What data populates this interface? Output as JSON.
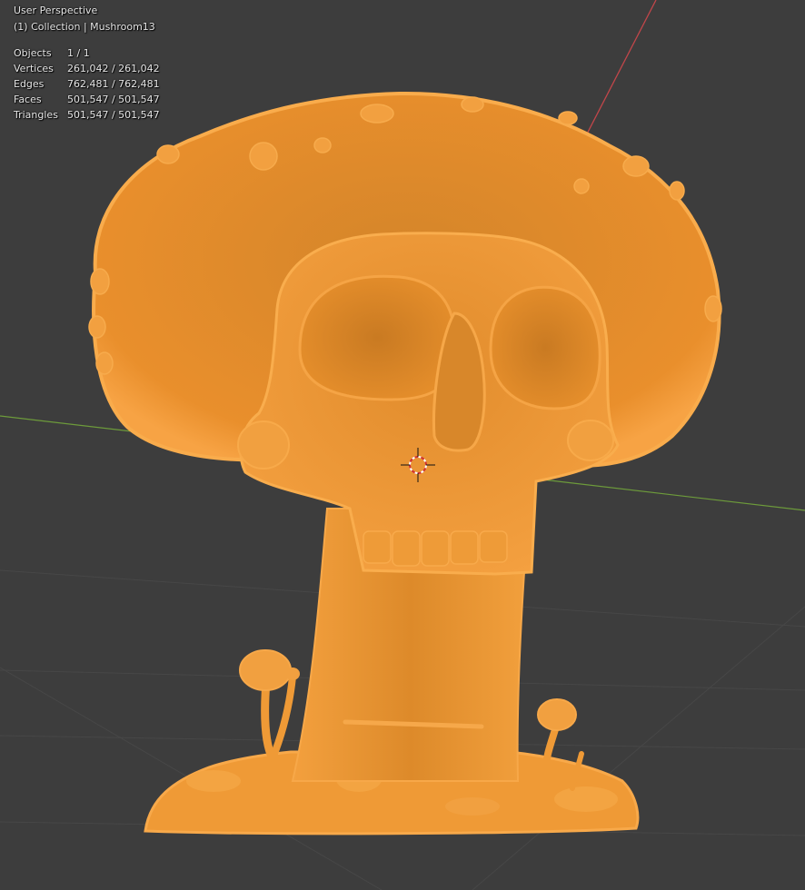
{
  "viewport": {
    "view_name": "User Perspective",
    "collection_line": "(1) Collection | Mushroom13",
    "colors": {
      "background": "#3d3d3d",
      "object_selected": "#f2962f",
      "x_axis": "#c2464a",
      "y_axis": "#6d9b3b",
      "text": "#e6e6e6"
    },
    "stats": [
      {
        "label": "Objects",
        "value": "1 / 1"
      },
      {
        "label": "Vertices",
        "value": "261,042 / 261,042"
      },
      {
        "label": "Edges",
        "value": "762,481 / 762,481"
      },
      {
        "label": "Faces",
        "value": "501,547 / 501,547"
      },
      {
        "label": "Triangles",
        "value": "501,547 / 501,547"
      }
    ],
    "icons": [
      "3d-cursor-icon"
    ]
  }
}
